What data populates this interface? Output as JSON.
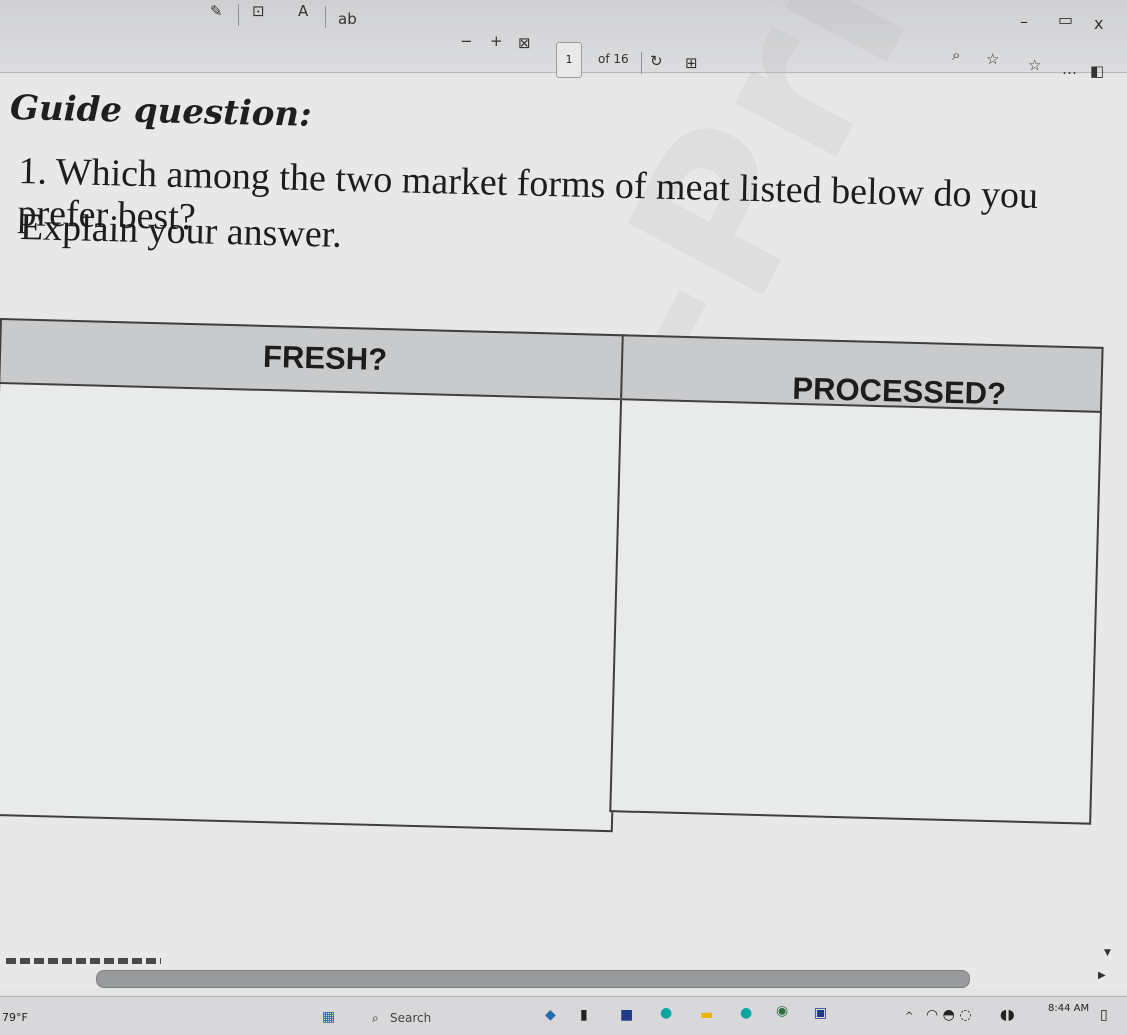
{
  "toolbar": {
    "ab_label": "ab",
    "page_count": "of 16",
    "page_field": "1",
    "zoom_out": "−",
    "zoom_in": "+"
  },
  "window": {
    "minimize": "–",
    "close": "x"
  },
  "document": {
    "heading": "Guide question:",
    "question_line1": "1. Which among the two market forms of meat listed below do you prefer best?",
    "question_line2": "Explain your answer.",
    "table": {
      "col1_header": "FRESH?",
      "col2_header": "PROCESSED?"
    }
  },
  "taskbar": {
    "search_label": "Search",
    "clock": "8:44 AM",
    "weather": "79°F"
  }
}
